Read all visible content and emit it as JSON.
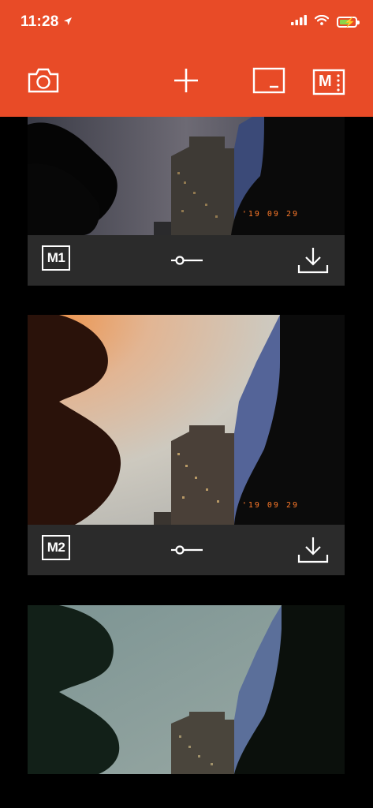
{
  "status_bar": {
    "time": "11:28",
    "icons": [
      "location-arrow-icon",
      "cellular-signal-icon",
      "wifi-icon",
      "battery-charging-icon"
    ]
  },
  "toolbar": {
    "buttons": [
      "camera-icon",
      "add-icon",
      "frame-icon",
      "mode-menu-icon"
    ],
    "mode_menu_label": "M"
  },
  "photos": [
    {
      "mode_label": "M1",
      "datestamp": "'19 09 29",
      "controls": [
        "adjust-slider-icon",
        "download-icon"
      ]
    },
    {
      "mode_label": "M2",
      "datestamp": "'19 09 29",
      "controls": [
        "adjust-slider-icon",
        "download-icon"
      ]
    },
    {
      "mode_label": "",
      "datestamp": "",
      "controls": []
    }
  ],
  "colors": {
    "accent": "#e84b27",
    "background": "#000000",
    "card_bar": "#2b2b2b",
    "datestamp": "#ff7a2a"
  }
}
